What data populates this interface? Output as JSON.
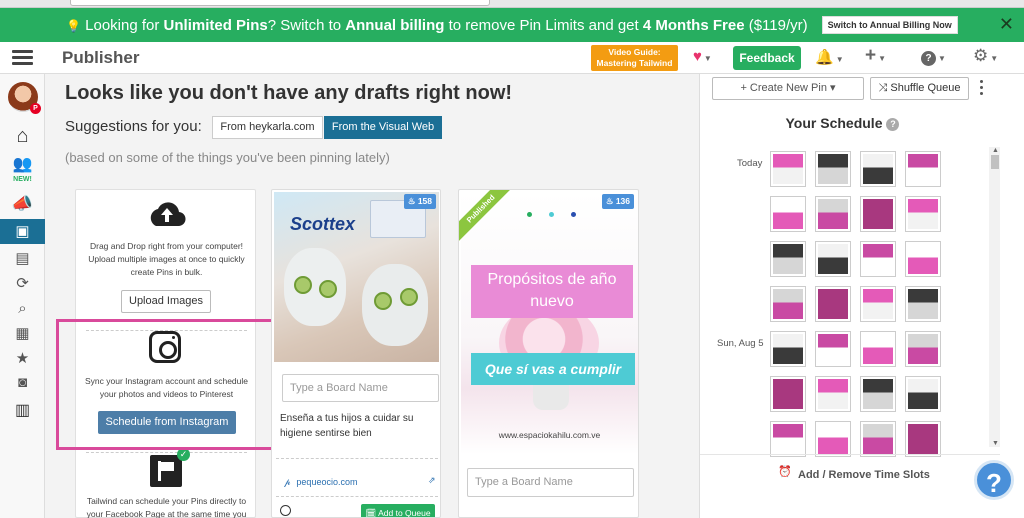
{
  "banner": {
    "prefix": "Looking for ",
    "unlimited": "Unlimited Pins",
    "mid1": "? Switch to ",
    "annual": "Annual billing",
    "mid2": " to remove Pin Limits and get ",
    "months": "4 Months Free",
    "suffix": " ($119/yr)",
    "button": "Switch to Annual Billing Now",
    "close": "✕"
  },
  "header": {
    "title": "Publisher",
    "video_guide_line1": "Video Guide:",
    "video_guide_line2": "Mastering Tailwind",
    "feedback": "Feedback"
  },
  "nav": {
    "new_tag": "NEW!"
  },
  "main": {
    "heading": "Looks like you don't have any drafts right now!",
    "suggestions_label": "Suggestions for you:",
    "tab_from_site": "From heykarla.com",
    "tab_visual_web": "From the Visual Web",
    "based_on": "(based on some of the things you've been pinning lately)"
  },
  "upload_card": {
    "upload_text": "Drag and Drop right from your computer! Upload multiple images at once to quickly create Pins in bulk.",
    "upload_button": "Upload Images",
    "instagram_text": "Sync your Instagram account and schedule your photos and videos to Pinterest",
    "instagram_button": "Schedule from Instagram",
    "facebook_text": "Tailwind can schedule your Pins directly to your Facebook Page at the same time you"
  },
  "pin1": {
    "badge": "158",
    "image_logo": "Scottex",
    "board_placeholder": "Type a Board Name",
    "description": "Enseña a tus hijos a cuidar su higiene sentirse bien",
    "link": "pequeocio.com",
    "add_button": "Add to Queue"
  },
  "pin2": {
    "badge": "136",
    "ribbon": "Published",
    "title": "Propósitos de año nuevo",
    "subtitle": "Que sí vas a cumplir",
    "footer_url": "www.espaciokahilu.com.ve",
    "board_placeholder": "Type a Board Name"
  },
  "schedule": {
    "create_new_pin": "Create New Pin",
    "shuffle_queue": "Shuffle Queue",
    "title": "Your Schedule",
    "days": [
      "Today",
      "Sun, Aug 5"
    ],
    "add_remove": "Add / Remove Time Slots"
  },
  "colors": {
    "banner_green": "#27ae60",
    "brand_blue": "#1b6f95",
    "highlight_pink": "#d94a9b"
  },
  "icons": {
    "menu": "hamburger-icon",
    "heart": "heart-icon",
    "bell": "bell-icon",
    "plus": "plus-icon",
    "help": "question-icon",
    "settings": "gear-icon"
  },
  "help_glyph": "?"
}
